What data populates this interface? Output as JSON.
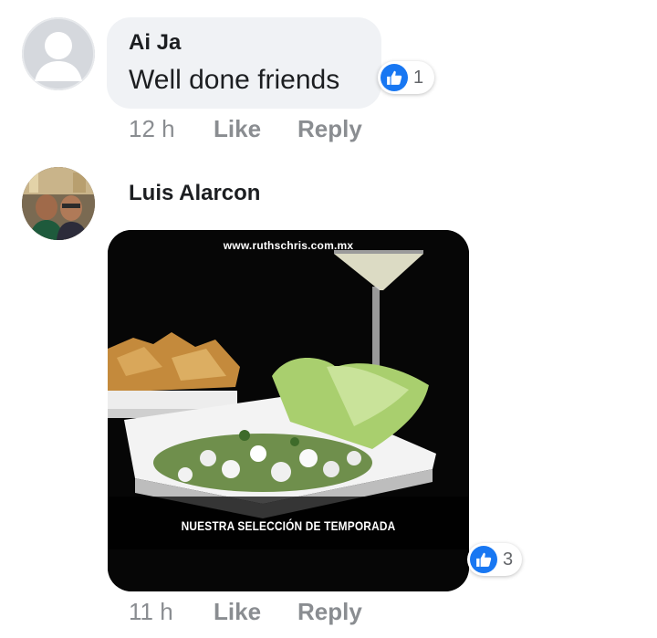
{
  "comments": [
    {
      "author": "Ai Ja",
      "text": "Well done friends",
      "reaction_count": "1",
      "time": "12 h",
      "like_label": "Like",
      "reply_label": "Reply"
    },
    {
      "author": "Luis Alarcon",
      "media": {
        "watermark_url": "www.ruthschris.com.mx",
        "caption": "NUESTRA SELECCIÓN DE TEMPORADA"
      },
      "reaction_count": "3",
      "time": "11 h",
      "like_label": "Like",
      "reply_label": "Reply"
    }
  ],
  "colors": {
    "like_blue": "#1877f2",
    "bubble_bg": "#f0f2f5",
    "meta_gray": "#8a8d91"
  },
  "icons": [
    "default-avatar-icon",
    "thumbs-up-icon"
  ]
}
